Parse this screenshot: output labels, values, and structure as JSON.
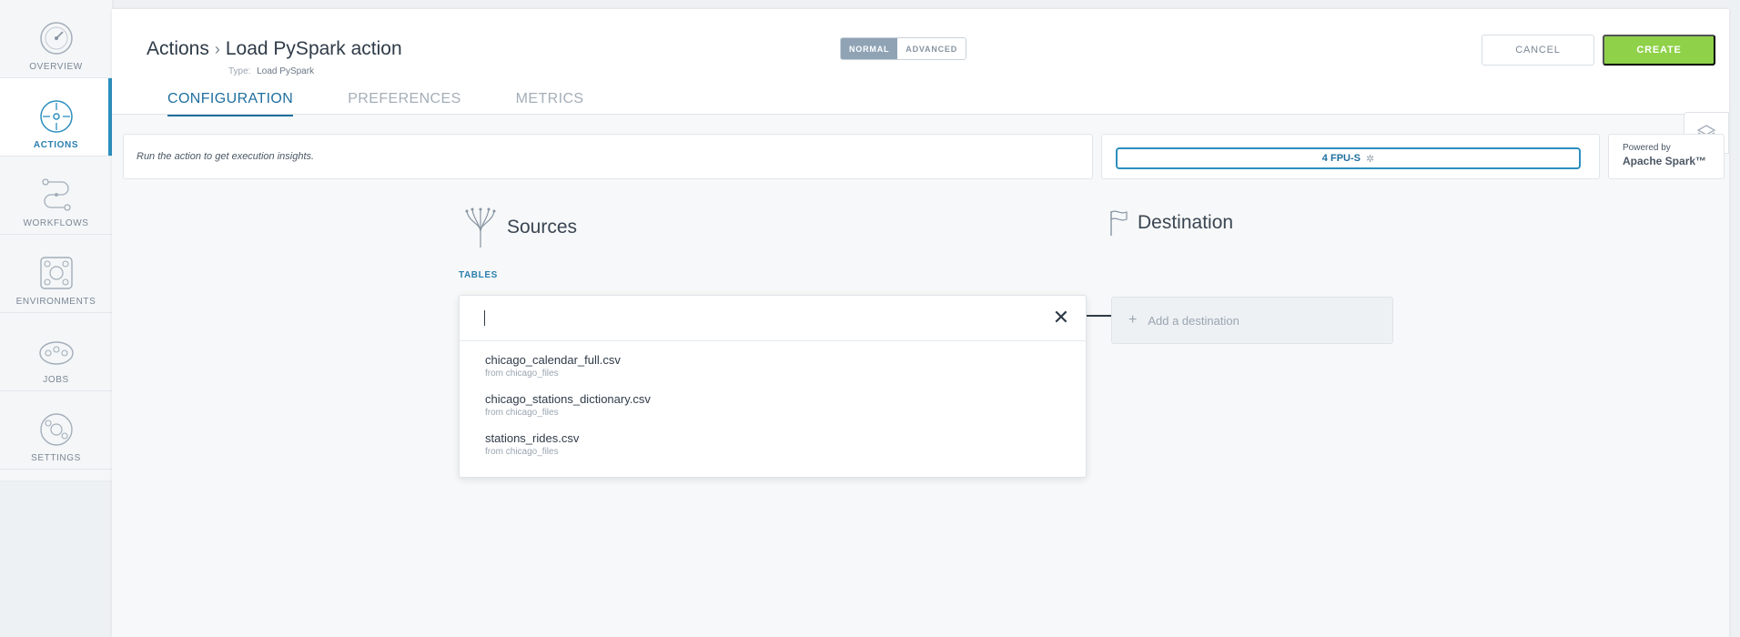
{
  "sidebar": {
    "items": [
      {
        "label": "OVERVIEW",
        "icon": "gauge-icon"
      },
      {
        "label": "ACTIONS",
        "icon": "crosshair-icon",
        "active": true
      },
      {
        "label": "WORKFLOWS",
        "icon": "workflow-icon"
      },
      {
        "label": "ENVIRONMENTS",
        "icon": "environment-icon"
      },
      {
        "label": "JOBS",
        "icon": "jobs-icon"
      },
      {
        "label": "SETTINGS",
        "icon": "settings-icon"
      }
    ]
  },
  "header": {
    "breadcrumb_root": "Actions",
    "breadcrumb_current": "Load PySpark action",
    "type_label": "Type:",
    "type_value": "Load PySpark",
    "mode_normal": "NORMAL",
    "mode_advanced": "ADVANCED",
    "cancel_label": "CANCEL",
    "create_label": "CREATE"
  },
  "tabs": [
    "CONFIGURATION",
    "PREFERENCES",
    "METRICS"
  ],
  "insights": {
    "message": "Run the action to get execution insights.",
    "fpu": "4 FPU-S",
    "powered_small": "Powered by",
    "powered_big": "Apache Spark™"
  },
  "sources": {
    "title": "Sources",
    "tables_label": "TABLES",
    "search_value": "",
    "options": [
      {
        "name": "chicago_calendar_full.csv",
        "source": "from chicago_files"
      },
      {
        "name": "chicago_stations_dictionary.csv",
        "source": "from chicago_files"
      },
      {
        "name": "stations_rides.csv",
        "source": "from chicago_files"
      }
    ]
  },
  "destination": {
    "title": "Destination",
    "add_label": "Add a destination"
  },
  "colors": {
    "accent": "#2b8fbf",
    "create": "#8fd148",
    "mode_active": "#8fa3b5"
  }
}
